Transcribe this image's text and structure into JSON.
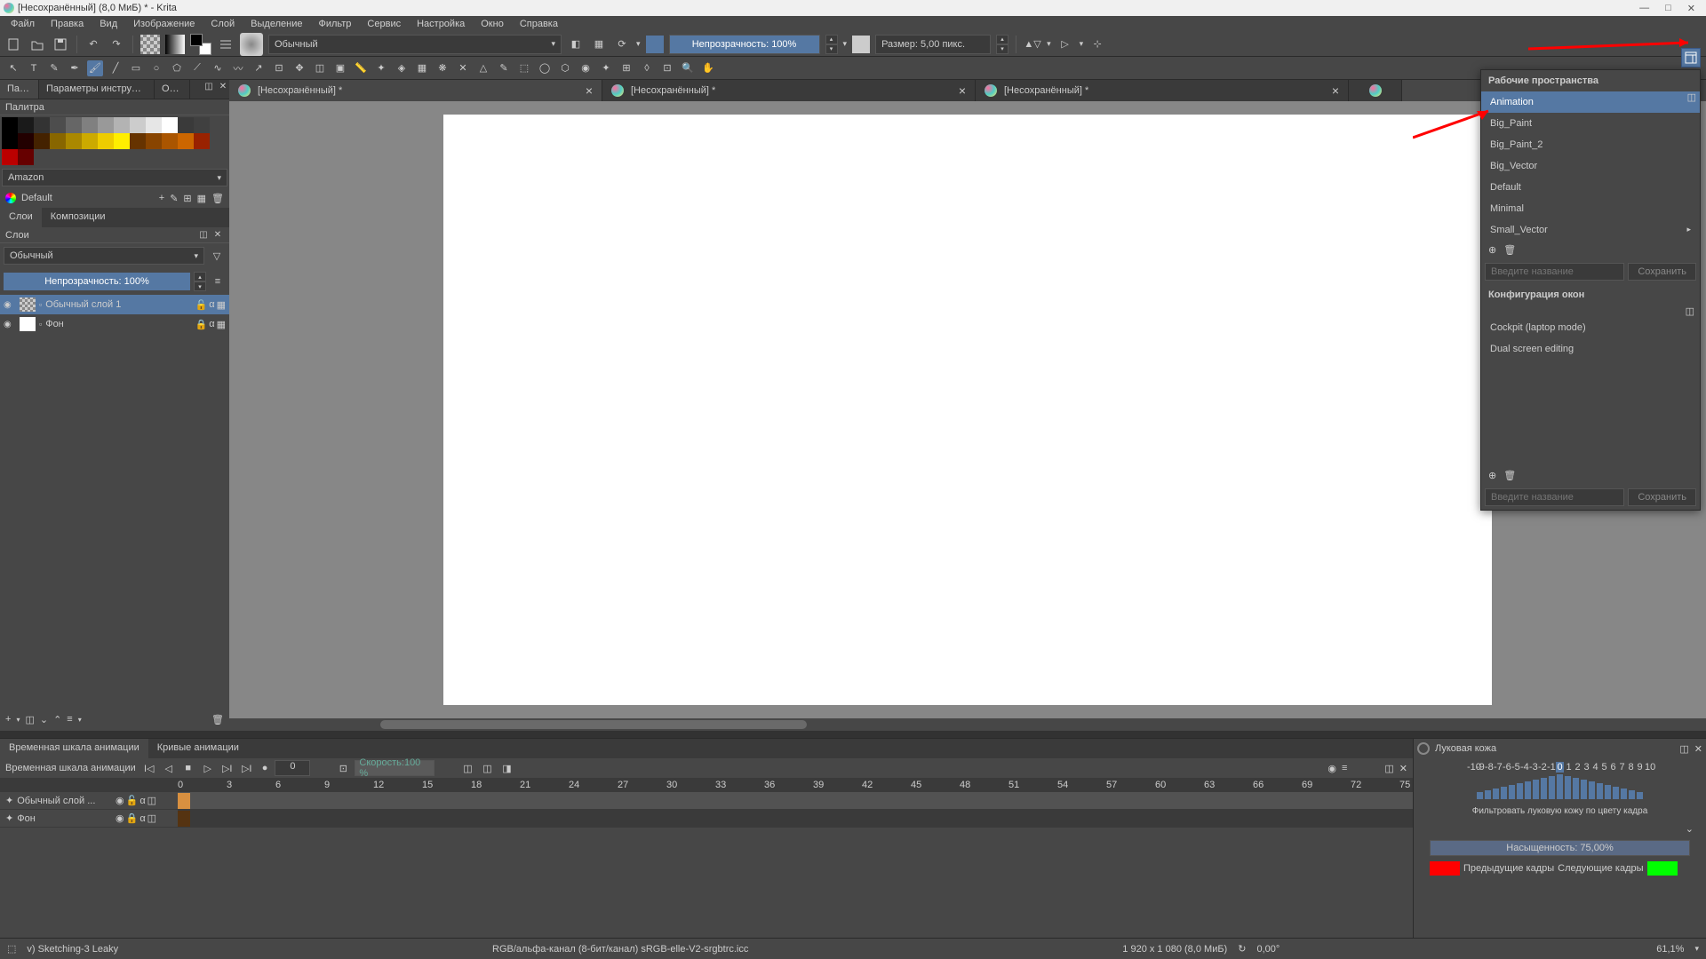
{
  "title": "[Несохранённый]  (8,0 МиБ)  * - Krita",
  "menu": [
    "Файл",
    "Правка",
    "Вид",
    "Изображение",
    "Слой",
    "Выделение",
    "Фильтр",
    "Сервис",
    "Настройка",
    "Окно",
    "Справка"
  ],
  "toolbar": {
    "blendmode": "Обычный",
    "opacity": "Непрозрачность: 100%",
    "size": "Размер: 5,00 пикс."
  },
  "docks": {
    "tabs": [
      "Пал...",
      "Параметры инструмен...",
      "Об..."
    ],
    "palette_header": "Палитра",
    "palette_name": "Amazon",
    "palette_default": "Default",
    "colors_row1": [
      "#000000",
      "#1a1a1a",
      "#333333",
      "#4d4d4d",
      "#666666",
      "#808080",
      "#999999",
      "#b3b3b3",
      "#cccccc",
      "#e6e6e6",
      "#ffffff",
      "#3a3a3a",
      "#404040",
      "#000000"
    ],
    "colors_row2": [
      "#220000",
      "#442200",
      "#886600",
      "#aa8800",
      "#ccaa00",
      "#eecc00",
      "#ffee00",
      "#663300",
      "#884400",
      "#aa5500",
      "#cc6600",
      "#992200",
      "#bb0000",
      "#660000"
    ]
  },
  "layers": {
    "tab1": "Слои",
    "tab2": "Композиции",
    "header": "Слои",
    "blendmode": "Обычный",
    "opacity": "Непрозрачность:  100%",
    "items": [
      {
        "name": "Обычный слой 1"
      },
      {
        "name": "Фон"
      }
    ]
  },
  "tabs": [
    "[Несохранённый] *",
    "[Несохранённый] *",
    "[Несохранённый] *"
  ],
  "timeline": {
    "tab1": "Временная шкала анимации",
    "tab2": "Кривые анимации",
    "header": "Временная шкала анимации",
    "frame": "0",
    "speed": "Скорость:100 %",
    "ruler": [
      "0",
      "3",
      "6",
      "9",
      "12",
      "15",
      "18",
      "21",
      "24",
      "27",
      "30",
      "33",
      "36",
      "39",
      "42",
      "45",
      "48",
      "51",
      "54",
      "57",
      "60",
      "63",
      "66",
      "69",
      "72",
      "75"
    ],
    "tracks": [
      "Обычный слой ...",
      "Фон"
    ]
  },
  "onion": {
    "title": "Луковая кожа",
    "numbers": [
      "-10",
      "-9",
      "-8",
      "-7",
      "-6",
      "-5",
      "-4",
      "-3",
      "-2",
      "-1",
      "0",
      "1",
      "2",
      "3",
      "4",
      "5",
      "6",
      "7",
      "8",
      "9",
      "10"
    ],
    "filter": "Фильтровать луковую кожу по цвету кадра",
    "saturation": "Насыщенность: 75,00%",
    "prev": "Предыдущие кадры",
    "next": "Следующие кадры"
  },
  "status": {
    "brush": "v) Sketching-3 Leaky",
    "colorspace": "RGB/альфа-канал (8-бит/канал)  sRGB-elle-V2-srgbtrc.icc",
    "dims": "1 920 x 1 080 (8,0 МиБ)",
    "angle": "0,00°",
    "zoom": "61,1%"
  },
  "workspace": {
    "title": "Рабочие пространства",
    "items": [
      "Animation",
      "Big_Paint",
      "Big_Paint_2",
      "Big_Vector",
      "Default",
      "Minimal",
      "Small_Vector"
    ],
    "placeholder": "Введите название",
    "save": "Сохранить",
    "subtitle": "Конфигурация окон",
    "configs": [
      "Cockpit (laptop mode)",
      "Dual screen editing"
    ]
  }
}
